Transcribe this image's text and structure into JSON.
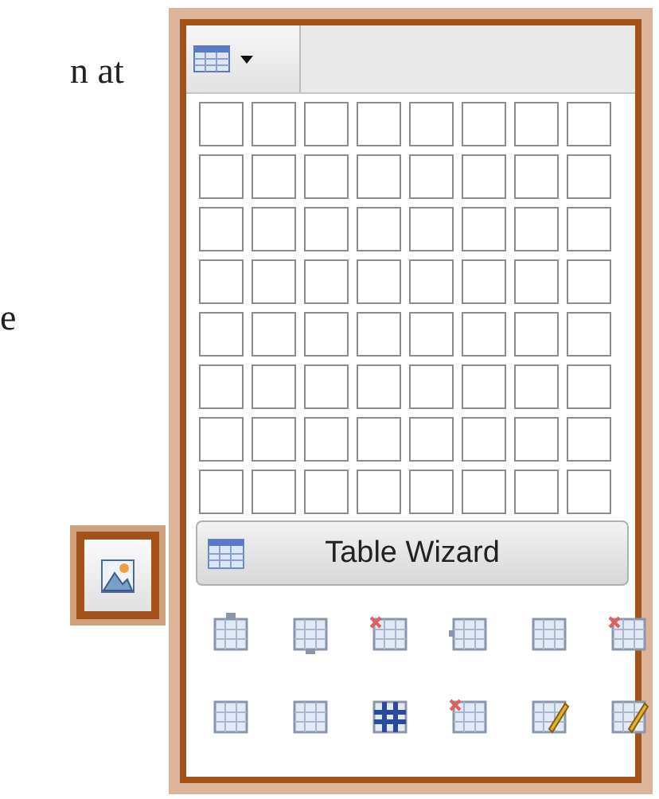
{
  "document_text": [
    "n at",
    "e"
  ],
  "table_menu": {
    "wizard_button": "Table Wizard"
  }
}
